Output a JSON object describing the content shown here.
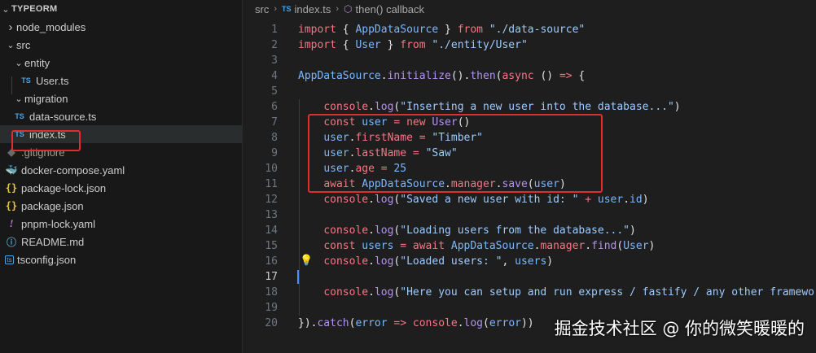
{
  "explorer": {
    "root": "TYPEORM",
    "items": [
      {
        "label": "node_modules",
        "kind": "folder-closed",
        "depth": 0
      },
      {
        "label": "src",
        "kind": "folder-open",
        "depth": 0
      },
      {
        "label": "entity",
        "kind": "folder-open",
        "depth": 1
      },
      {
        "label": "User.ts",
        "kind": "ts",
        "depth": 2
      },
      {
        "label": "migration",
        "kind": "folder-open",
        "depth": 1
      },
      {
        "label": "data-source.ts",
        "kind": "ts",
        "depth": 1
      },
      {
        "label": "index.ts",
        "kind": "ts",
        "depth": 1,
        "selected": true
      },
      {
        "label": ".gitignore",
        "kind": "git",
        "depth": 0
      },
      {
        "label": "docker-compose.yaml",
        "kind": "docker",
        "depth": 0
      },
      {
        "label": "package-lock.json",
        "kind": "json",
        "depth": 0
      },
      {
        "label": "package.json",
        "kind": "json",
        "depth": 0
      },
      {
        "label": "pnpm-lock.yaml",
        "kind": "yaml",
        "depth": 0
      },
      {
        "label": "README.md",
        "kind": "info",
        "depth": 0
      },
      {
        "label": "tsconfig.json",
        "kind": "tsconfig",
        "depth": 0
      }
    ]
  },
  "breadcrumb": {
    "folder": "src",
    "file": "index.ts",
    "symbol": "then() callback"
  },
  "icons": {
    "ts": "TS",
    "json": "{}",
    "yaml": "!",
    "git": "◆",
    "docker": "🐳",
    "info": "ⓘ",
    "tsconfig": "ts"
  },
  "editor": {
    "active_line": 17,
    "lines": [
      {
        "n": "1",
        "tokens": [
          [
            "t-kw",
            "import"
          ],
          [
            "t-plain",
            " { "
          ],
          [
            "t-id",
            "AppDataSource"
          ],
          [
            "t-plain",
            " } "
          ],
          [
            "t-kw",
            "from"
          ],
          [
            "t-plain",
            " "
          ],
          [
            "t-str",
            "\"./data-source\""
          ]
        ]
      },
      {
        "n": "2",
        "tokens": [
          [
            "t-kw",
            "import"
          ],
          [
            "t-plain",
            " { "
          ],
          [
            "t-id",
            "User"
          ],
          [
            "t-plain",
            " } "
          ],
          [
            "t-kw",
            "from"
          ],
          [
            "t-plain",
            " "
          ],
          [
            "t-str",
            "\"./entity/User\""
          ]
        ]
      },
      {
        "n": "3",
        "tokens": []
      },
      {
        "n": "4",
        "tokens": [
          [
            "t-id",
            "AppDataSource"
          ],
          [
            "t-plain",
            "."
          ],
          [
            "t-fn",
            "initialize"
          ],
          [
            "t-plain",
            "()."
          ],
          [
            "t-fn",
            "then"
          ],
          [
            "t-plain",
            "("
          ],
          [
            "t-kw",
            "async"
          ],
          [
            "t-plain",
            " () "
          ],
          [
            "t-kw",
            "=>"
          ],
          [
            "t-plain",
            " {"
          ]
        ]
      },
      {
        "n": "5",
        "tokens": []
      },
      {
        "n": "6",
        "tokens": [
          [
            "t-plain",
            "    "
          ],
          [
            "t-obj",
            "console"
          ],
          [
            "t-plain",
            "."
          ],
          [
            "t-fn",
            "log"
          ],
          [
            "t-plain",
            "("
          ],
          [
            "t-str",
            "\"Inserting a new user into the database...\""
          ],
          [
            "t-plain",
            ")"
          ]
        ]
      },
      {
        "n": "7",
        "tokens": [
          [
            "t-plain",
            "    "
          ],
          [
            "t-kw",
            "const"
          ],
          [
            "t-plain",
            " "
          ],
          [
            "t-id",
            "user"
          ],
          [
            "t-plain",
            " "
          ],
          [
            "t-kw",
            "="
          ],
          [
            "t-plain",
            " "
          ],
          [
            "t-kw",
            "new"
          ],
          [
            "t-plain",
            " "
          ],
          [
            "t-fn",
            "User"
          ],
          [
            "t-plain",
            "()"
          ]
        ]
      },
      {
        "n": "8",
        "tokens": [
          [
            "t-plain",
            "    "
          ],
          [
            "t-id",
            "user"
          ],
          [
            "t-plain",
            "."
          ],
          [
            "t-obj",
            "firstName"
          ],
          [
            "t-plain",
            " "
          ],
          [
            "t-kw",
            "="
          ],
          [
            "t-plain",
            " "
          ],
          [
            "t-str",
            "\"Timber\""
          ]
        ]
      },
      {
        "n": "9",
        "tokens": [
          [
            "t-plain",
            "    "
          ],
          [
            "t-id",
            "user"
          ],
          [
            "t-plain",
            "."
          ],
          [
            "t-obj",
            "lastName"
          ],
          [
            "t-plain",
            " "
          ],
          [
            "t-kw",
            "="
          ],
          [
            "t-plain",
            " "
          ],
          [
            "t-str",
            "\"Saw\""
          ]
        ]
      },
      {
        "n": "10",
        "tokens": [
          [
            "t-plain",
            "    "
          ],
          [
            "t-id",
            "user"
          ],
          [
            "t-plain",
            "."
          ],
          [
            "t-obj",
            "age"
          ],
          [
            "t-plain",
            " "
          ],
          [
            "t-kw",
            "="
          ],
          [
            "t-plain",
            " "
          ],
          [
            "t-num",
            "25"
          ]
        ]
      },
      {
        "n": "11",
        "tokens": [
          [
            "t-plain",
            "    "
          ],
          [
            "t-kw",
            "await"
          ],
          [
            "t-plain",
            " "
          ],
          [
            "t-id",
            "AppDataSource"
          ],
          [
            "t-plain",
            "."
          ],
          [
            "t-obj",
            "manager"
          ],
          [
            "t-plain",
            "."
          ],
          [
            "t-fn",
            "save"
          ],
          [
            "t-plain",
            "("
          ],
          [
            "t-id",
            "user"
          ],
          [
            "t-plain",
            ")"
          ]
        ]
      },
      {
        "n": "12",
        "tokens": [
          [
            "t-plain",
            "    "
          ],
          [
            "t-obj",
            "console"
          ],
          [
            "t-plain",
            "."
          ],
          [
            "t-fn",
            "log"
          ],
          [
            "t-plain",
            "("
          ],
          [
            "t-str",
            "\"Saved a new user with id: \""
          ],
          [
            "t-plain",
            " "
          ],
          [
            "t-kw",
            "+"
          ],
          [
            "t-plain",
            " "
          ],
          [
            "t-id",
            "user"
          ],
          [
            "t-plain",
            "."
          ],
          [
            "t-id",
            "id"
          ],
          [
            "t-plain",
            ")"
          ]
        ]
      },
      {
        "n": "13",
        "tokens": []
      },
      {
        "n": "14",
        "tokens": [
          [
            "t-plain",
            "    "
          ],
          [
            "t-obj",
            "console"
          ],
          [
            "t-plain",
            "."
          ],
          [
            "t-fn",
            "log"
          ],
          [
            "t-plain",
            "("
          ],
          [
            "t-str",
            "\"Loading users from the database...\""
          ],
          [
            "t-plain",
            ")"
          ]
        ]
      },
      {
        "n": "15",
        "tokens": [
          [
            "t-plain",
            "    "
          ],
          [
            "t-kw",
            "const"
          ],
          [
            "t-plain",
            " "
          ],
          [
            "t-id",
            "users"
          ],
          [
            "t-plain",
            " "
          ],
          [
            "t-kw",
            "="
          ],
          [
            "t-plain",
            " "
          ],
          [
            "t-kw",
            "await"
          ],
          [
            "t-plain",
            " "
          ],
          [
            "t-id",
            "AppDataSource"
          ],
          [
            "t-plain",
            "."
          ],
          [
            "t-obj",
            "manager"
          ],
          [
            "t-plain",
            "."
          ],
          [
            "t-fn",
            "find"
          ],
          [
            "t-plain",
            "("
          ],
          [
            "t-id",
            "User"
          ],
          [
            "t-plain",
            ")"
          ]
        ]
      },
      {
        "n": "16",
        "tokens": [
          [
            "t-plain",
            "    "
          ],
          [
            "t-obj",
            "console"
          ],
          [
            "t-plain",
            "."
          ],
          [
            "t-fn",
            "log"
          ],
          [
            "t-plain",
            "("
          ],
          [
            "t-str",
            "\"Loaded users: \""
          ],
          [
            "t-plain",
            ", "
          ],
          [
            "t-id",
            "users"
          ],
          [
            "t-plain",
            ")"
          ]
        ]
      },
      {
        "n": "17",
        "tokens": []
      },
      {
        "n": "18",
        "tokens": [
          [
            "t-plain",
            "    "
          ],
          [
            "t-obj",
            "console"
          ],
          [
            "t-plain",
            "."
          ],
          [
            "t-fn",
            "log"
          ],
          [
            "t-plain",
            "("
          ],
          [
            "t-str",
            "\"Here you can setup and run express / fastify / any other framework.\""
          ],
          [
            "t-plain",
            ")"
          ]
        ]
      },
      {
        "n": "19",
        "tokens": []
      },
      {
        "n": "20",
        "tokens": [
          [
            "t-plain",
            "})."
          ],
          [
            "t-fn",
            "catch"
          ],
          [
            "t-plain",
            "("
          ],
          [
            "t-id",
            "error"
          ],
          [
            "t-plain",
            " "
          ],
          [
            "t-kw",
            "=>"
          ],
          [
            "t-plain",
            " "
          ],
          [
            "t-obj",
            "console"
          ],
          [
            "t-plain",
            "."
          ],
          [
            "t-fn",
            "log"
          ],
          [
            "t-plain",
            "("
          ],
          [
            "t-id",
            "error"
          ],
          [
            "t-plain",
            "))"
          ]
        ]
      }
    ]
  },
  "watermark": "掘金技术社区 @ 你的微笑暖暖的"
}
